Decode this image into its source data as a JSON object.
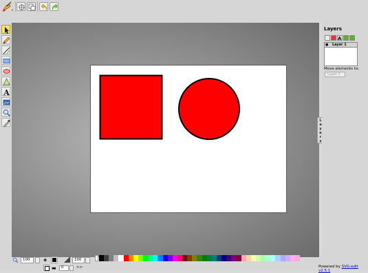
{
  "toolbar": {
    "logo_icon": "svg-edit-logo-icon",
    "buttons": [
      "wireframe-icon",
      "doc-properties-icon",
      "undo-icon",
      "redo-icon"
    ]
  },
  "tools": [
    "select-icon",
    "pencil-icon",
    "line-icon",
    "rectangle-icon",
    "ellipse-icon",
    "path-icon",
    "text-icon",
    "image-icon",
    "zoom-icon",
    "eyedropper-icon"
  ],
  "canvas": {
    "shapes": [
      {
        "type": "rect",
        "fill": "#ff0000",
        "stroke": "#000000"
      },
      {
        "type": "circle",
        "fill": "#ff0000",
        "stroke": "#000000"
      }
    ]
  },
  "layers_panel": {
    "title": "Layers",
    "tab_label": "Layers",
    "tab_letters": [
      "L",
      "a",
      "y",
      "e",
      "r",
      "s"
    ],
    "layers": [
      {
        "name": "Layer 1",
        "visible": true
      }
    ],
    "move_label": "Move elements to:",
    "move_select_value": "Layer 1"
  },
  "bottom": {
    "zoom_value": "100",
    "fill_color": "#000000",
    "opacity_value": "100",
    "stroke_color": "#000000",
    "stroke_width": "0",
    "more_label": ">>",
    "powered_text": "Powered by",
    "powered_link": "SVG-edit v2.5.1"
  },
  "palette": [
    "#000000",
    "#3f3f3f",
    "#7f7f7f",
    "#bfbfbf",
    "#ffffff",
    "#ff0000",
    "#ff7f00",
    "#ffff00",
    "#7fff00",
    "#00ff00",
    "#00ff7f",
    "#00ffff",
    "#007fff",
    "#0000ff",
    "#7f00ff",
    "#ff00ff",
    "#ff007f",
    "#7f0000",
    "#7f3f00",
    "#7f7f00",
    "#3f7f00",
    "#007f00",
    "#007f3f",
    "#007f7f",
    "#003f7f",
    "#00007f",
    "#3f007f",
    "#7f007f",
    "#7f003f",
    "#ffaaaa",
    "#ffd4aa",
    "#ffffaa",
    "#d4ffaa",
    "#aaffaa",
    "#aaffd4",
    "#aaffff",
    "#aad4ff",
    "#aaaaff",
    "#d4aaff",
    "#ffaaff",
    "#ffaad4"
  ]
}
